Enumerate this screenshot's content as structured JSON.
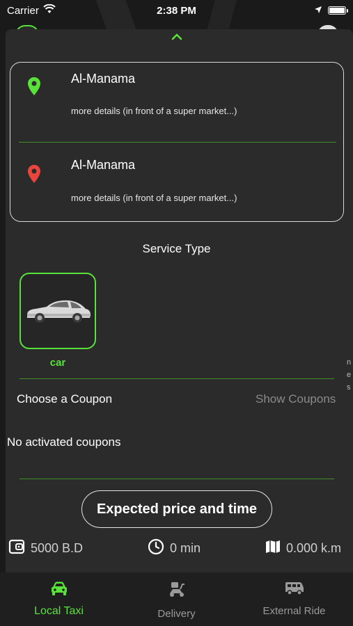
{
  "status_bar": {
    "carrier": "Carrier",
    "time": "2:38 PM"
  },
  "address_card": {
    "pickup": {
      "title": "Al-Manama",
      "detail": "more details (in front of a super market...)",
      "pin_color": "#59e33a"
    },
    "dropoff": {
      "title": "Al-Manama",
      "detail": "more details (in front of a super market...)",
      "pin_color": "#e8453c"
    }
  },
  "service": {
    "heading": "Service Type",
    "items": [
      {
        "label": "car",
        "icon": "car-icon",
        "selected": true
      }
    ]
  },
  "coupon": {
    "label": "Choose a Coupon",
    "link": "Show Coupons",
    "empty_text": "No activated coupons"
  },
  "estimate": {
    "button_label": "Expected price and time",
    "price": "5000 B.D",
    "time": "0 min",
    "distance": "0.000 k.m"
  },
  "tabs": [
    {
      "label": "Local Taxi",
      "icon": "taxi-icon",
      "active": true
    },
    {
      "label": "Delivery",
      "icon": "delivery-scooter-icon",
      "active": false
    },
    {
      "label": "External Ride",
      "icon": "van-icon",
      "active": false
    }
  ],
  "colors": {
    "accent": "#59e33a",
    "background": "#2b2b2b",
    "dropoff_pin": "#e8453c"
  }
}
